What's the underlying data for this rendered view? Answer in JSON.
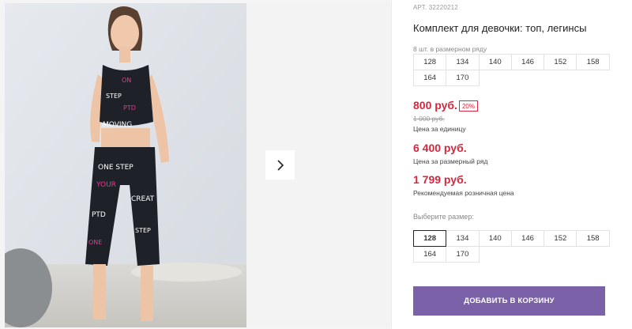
{
  "product": {
    "article": "АРТ. 32220212",
    "title": "Комплект для девочки: топ, легинсы"
  },
  "pack": {
    "label": "8 шт. в размерном ряду",
    "sizes": [
      "128",
      "134",
      "140",
      "146",
      "152",
      "158",
      "164",
      "170"
    ]
  },
  "prices": {
    "unit_price": "800 руб.",
    "discount": "20%",
    "old_price": "1 000 руб.",
    "unit_note": "Цена за единицу",
    "pack_price": "6 400 руб.",
    "pack_note": "Цена за размерный ряд",
    "retail_price": "1 799 руб.",
    "retail_note": "Рекомендуемая розничная цена"
  },
  "size_picker": {
    "label": "Выберите размер:",
    "sizes": [
      "128",
      "134",
      "140",
      "146",
      "152",
      "158",
      "164",
      "170"
    ],
    "selected": "128"
  },
  "actions": {
    "add_to_cart": "ДОБАВИТЬ В КОРЗИНУ"
  },
  "colors": {
    "price_red": "#d7263d",
    "cart_button": "#7b61a8"
  },
  "icons": {
    "next": "chevron-right-icon"
  }
}
